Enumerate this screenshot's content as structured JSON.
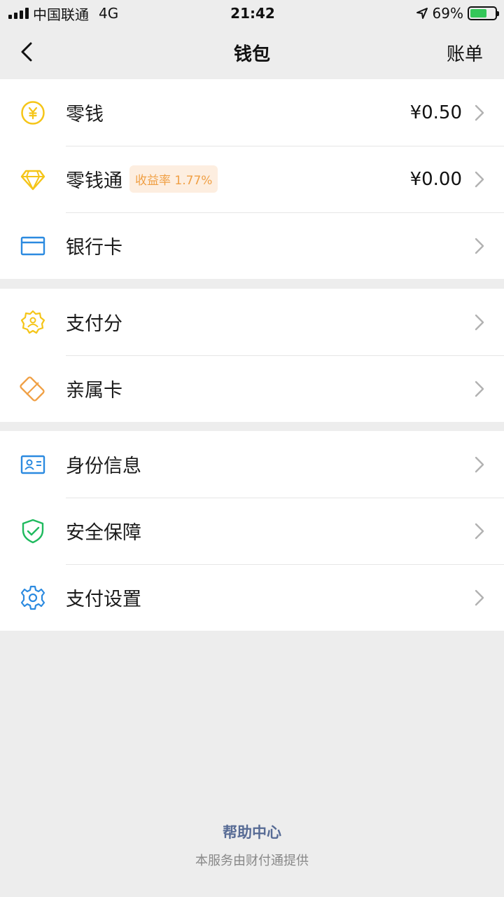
{
  "status_bar": {
    "carrier": "中国联通",
    "network": "4G",
    "time": "21:42",
    "battery_percent": "69%",
    "battery_level": 0.69,
    "icons": [
      "signal-icon",
      "location-arrow-icon",
      "battery-charging-icon"
    ]
  },
  "nav": {
    "back_icon": "chevron-left-icon",
    "title": "钱包",
    "action": "账单"
  },
  "groups": [
    {
      "items": [
        {
          "label": "零钱",
          "value": "¥0.50",
          "icon": "yuan-coin-icon",
          "color": "#f5c518"
        },
        {
          "label": "零钱通",
          "badge": "收益率 1.77%",
          "value": "¥0.00",
          "icon": "diamond-icon",
          "color": "#f5c518"
        },
        {
          "label": "银行卡",
          "icon": "bank-card-icon",
          "color": "#2b8ae0"
        }
      ]
    },
    {
      "items": [
        {
          "label": "支付分",
          "icon": "pay-score-badge-icon",
          "color": "#f5c518"
        },
        {
          "label": "亲属卡",
          "icon": "family-card-icon",
          "color": "#f0a045"
        }
      ]
    },
    {
      "items": [
        {
          "label": "身份信息",
          "icon": "id-card-icon",
          "color": "#2b8ae0"
        },
        {
          "label": "安全保障",
          "icon": "shield-check-icon",
          "color": "#1fba5e"
        },
        {
          "label": "支付设置",
          "icon": "gear-icon",
          "color": "#2b8ae0"
        }
      ]
    }
  ],
  "footer": {
    "help_center": "帮助中心",
    "provider_note": "本服务由财付通提供"
  },
  "colors": {
    "background": "#ededed",
    "link": "#576b95",
    "badge_bg": "#fdeee0",
    "badge_text": "#f0a045"
  }
}
